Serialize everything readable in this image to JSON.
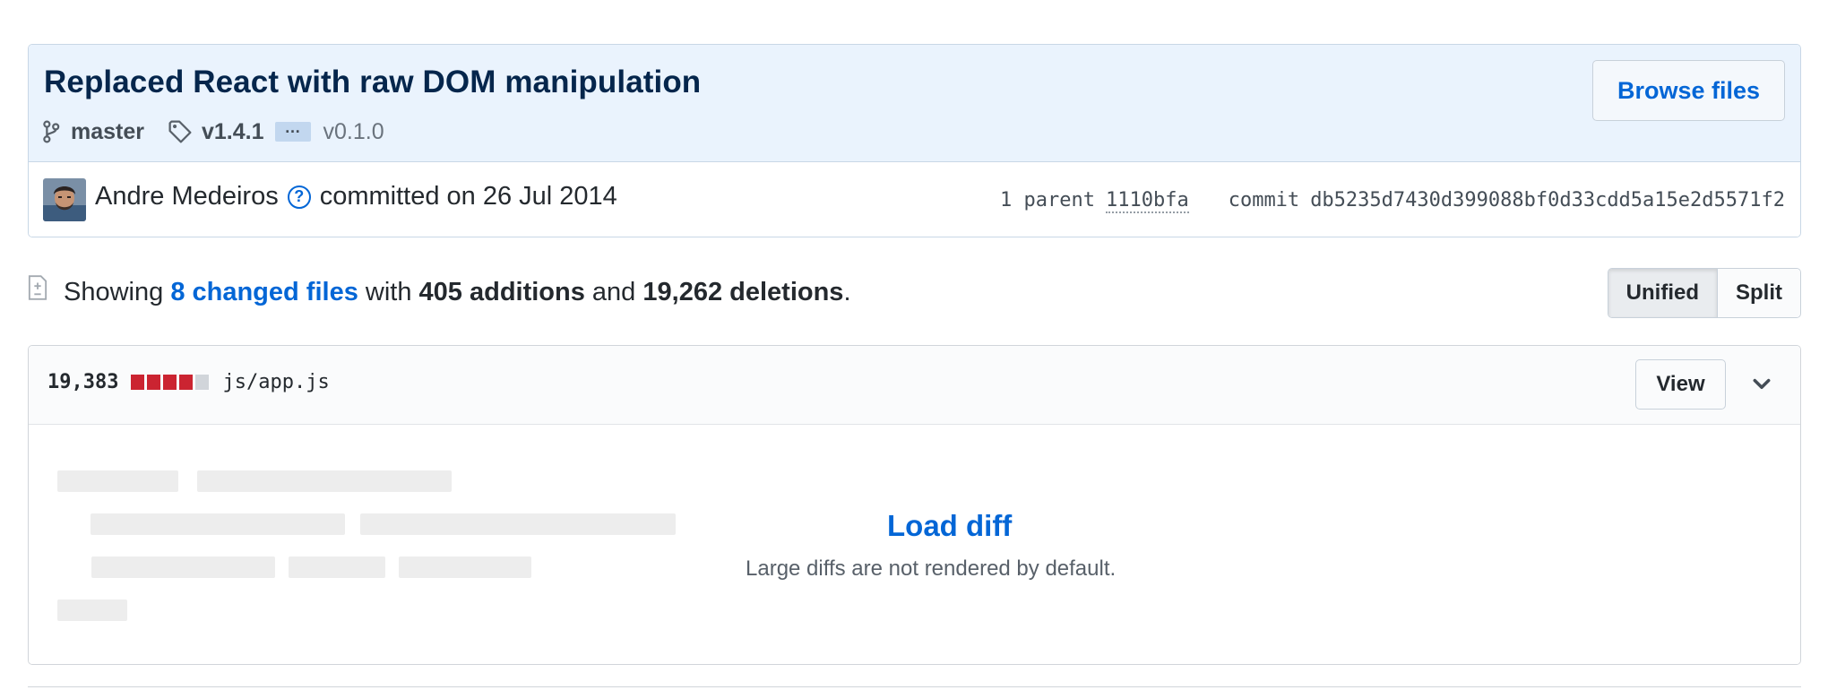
{
  "commit": {
    "title": "Replaced React with raw DOM manipulation",
    "branch": "master",
    "tag": "v1.4.1",
    "ellipsis": "…",
    "tag_end": "v0.1.0",
    "browse_label": "Browse files",
    "author": "Andre Medeiros",
    "committed_text": "committed on 26 Jul 2014",
    "help_glyph": "?",
    "parent_label": "1 parent",
    "parent_sha": "1110bfa",
    "commit_label": "commit",
    "commit_sha": "db5235d7430d399088bf0d33cdd5a15e2d5571f2"
  },
  "summary": {
    "showing": "Showing",
    "changed_files": "8 changed files",
    "with": "with",
    "additions": "405 additions",
    "and": "and",
    "deletions": "19,262 deletions",
    "period": "."
  },
  "view_toggle": {
    "unified": "Unified",
    "split": "Split",
    "selected": "Unified"
  },
  "file": {
    "change_count": "19,383",
    "diffstat": [
      "deletion",
      "deletion",
      "deletion",
      "deletion",
      "neutral"
    ],
    "path": "js/app.js",
    "view_label": "View",
    "load_diff": "Load diff",
    "load_note": "Large diffs are not rendered by default."
  },
  "colors": {
    "link": "#0366d6",
    "deletion": "#cb2431",
    "neutral": "#d1d5da",
    "header_bg": "#eaf3fd"
  },
  "icons": {
    "branch": "git-branch-icon",
    "tag": "tag-icon",
    "diff": "file-diff-icon",
    "help": "question-icon",
    "chevron": "chevron-down-icon"
  }
}
